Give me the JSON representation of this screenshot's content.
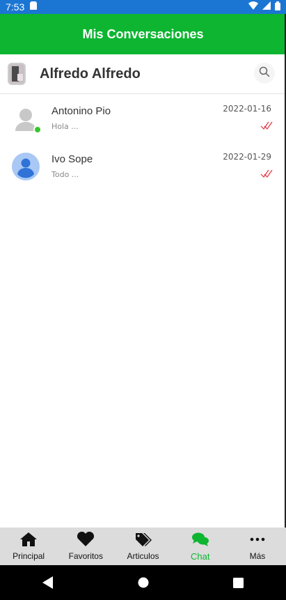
{
  "status_bar": {
    "time": "7:53",
    "icons": [
      "sd-card-icon",
      "wifi-icon",
      "signal-icon",
      "battery-icon"
    ]
  },
  "app_bar": {
    "title": "Mis Conversaciones",
    "color": "#0db531"
  },
  "user": {
    "name": "Alfredo Alfredo"
  },
  "conversations": [
    {
      "name": "Antonino Pio",
      "preview": "Hola ...",
      "date": "2022-01-16",
      "online": true,
      "avatar": "placeholder-grey"
    },
    {
      "name": "Ivo Sope",
      "preview": "Todo ...",
      "date": "2022-01-29",
      "online": false,
      "avatar": "placeholder-blue"
    }
  ],
  "bottom_nav": {
    "items": [
      {
        "label": "Principal",
        "icon": "home-icon"
      },
      {
        "label": "Favoritos",
        "icon": "heart-icon"
      },
      {
        "label": "Articulos",
        "icon": "tags-icon"
      },
      {
        "label": "Chat",
        "icon": "chat-icon",
        "active": true
      },
      {
        "label": "Más",
        "icon": "more-icon"
      }
    ],
    "active_color": "#0db531"
  }
}
